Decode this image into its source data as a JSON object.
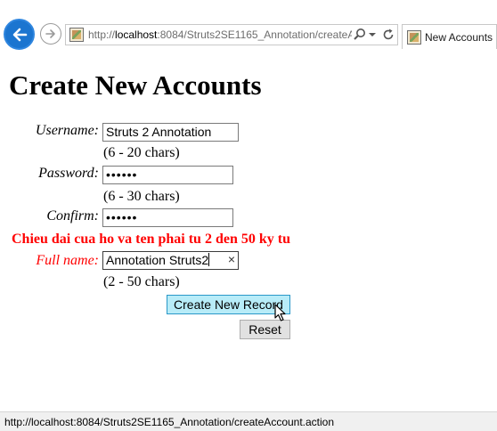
{
  "browser": {
    "url_prefix": "http://",
    "url_host": "localhost",
    "url_rest": ":8084/Struts2SE1165_Annotation/createA",
    "tab_title": "New Accounts",
    "status_url": "http://localhost:8084/Struts2SE1165_Annotation/createAccount.action",
    "icons": [
      "back-arrow-icon",
      "forward-arrow-icon",
      "page-favicon",
      "search-icon",
      "dropdown-icon",
      "refresh-icon"
    ],
    "accent_color": "#1b75d0"
  },
  "page": {
    "title": "Create New Accounts",
    "username_label": "Username:",
    "username_value": "Struts 2 Annotation",
    "username_hint": "(6 - 20 chars)",
    "password_label": "Password:",
    "password_value": "••••••",
    "password_hint": "(6 - 30 chars)",
    "confirm_label": "Confirm:",
    "confirm_value": "••••••",
    "error_message": "Chieu dai cua ho va ten phai tu 2 den 50 ky tu",
    "fullname_label": "Full name:",
    "fullname_value": "Annotation Struts2",
    "fullname_clear": "×",
    "fullname_hint": "(2 - 50 chars)",
    "create_button": "Create New Record",
    "reset_button": "Reset",
    "error_color": "#ff0000"
  }
}
